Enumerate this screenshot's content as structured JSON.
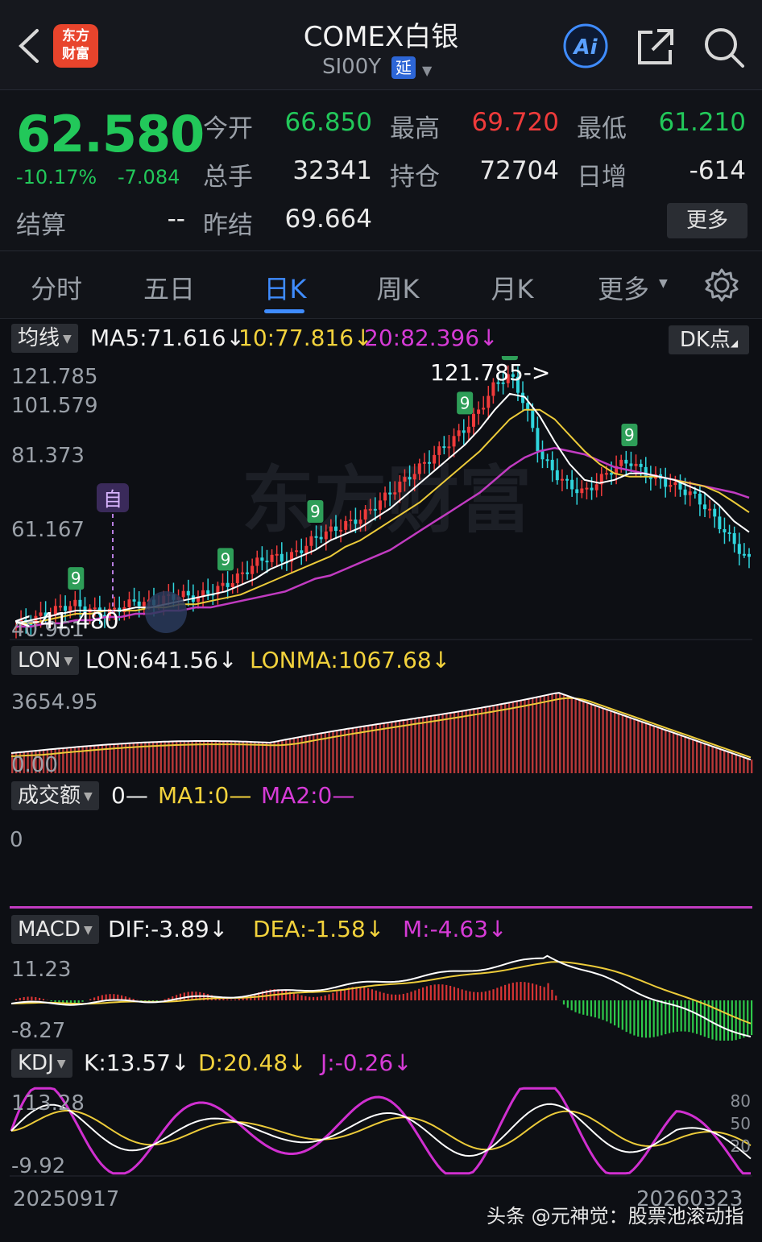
{
  "header": {
    "title": "COMEX白银",
    "subtitle": "SI00Y",
    "delay_badge": "延",
    "logo_line1": "东方",
    "logo_line2": "财富",
    "ai_label": "Ai"
  },
  "quote": {
    "price": "62.580",
    "change_pct": "-10.17%",
    "change": "-7.084",
    "fields": [
      {
        "label": "今开",
        "value": "66.850"
      },
      {
        "label": "最高",
        "value": "69.720"
      },
      {
        "label": "最低",
        "value": "61.210"
      },
      {
        "label": "总手",
        "value": "32341"
      },
      {
        "label": "持仓",
        "value": "72704"
      },
      {
        "label": "日增",
        "value": "-614"
      },
      {
        "label": "结算",
        "value": "--"
      },
      {
        "label": "昨结",
        "value": "69.664"
      }
    ],
    "more_label": "更多"
  },
  "tabs": [
    "分时",
    "五日",
    "日K",
    "周K",
    "月K",
    "更多"
  ],
  "active_tab": "日K",
  "main_chart": {
    "indicator": "均线",
    "ma5": "MA5:71.616",
    "ma10": "10:77.816",
    "ma20": "20:82.396",
    "dk_label": "DK点",
    "y_labels": [
      "121.785",
      "101.579",
      "81.373",
      "61.167",
      "40.961"
    ],
    "max_label": "121.785->",
    "min_label": "<-41.480",
    "marker_label": "自"
  },
  "lon_panel": {
    "name": "LON",
    "lon": "LON:641.56",
    "lonma": "LONMA:1067.68",
    "y_labels": [
      "3654.95",
      "0.00"
    ]
  },
  "vol_panel": {
    "name": "成交额",
    "v0": "0—",
    "ma1": "MA1:0—",
    "ma2": "MA2:0—",
    "y_label": "0"
  },
  "macd_panel": {
    "name": "MACD",
    "dif": "DIF:-3.89",
    "dea": "DEA:-1.58",
    "m": "M:-4.63",
    "y_labels": [
      "11.23",
      "-8.27"
    ]
  },
  "kdj_panel": {
    "name": "KDJ",
    "k": "K:13.57",
    "d": "D:20.48",
    "j": "J:-0.26",
    "y_labels": [
      "113.28",
      "-9.92"
    ],
    "right_labels": [
      "80",
      "50",
      "20"
    ]
  },
  "dates": {
    "start": "20250917",
    "end": "20260323"
  },
  "watermark": "头条 @元神觉：股票池滚动指",
  "chart_data": {
    "type": "line",
    "title": "COMEX白银 日K",
    "x_range": [
      "20250917",
      "20260323"
    ],
    "ylim": [
      40.961,
      121.785
    ],
    "series": [
      {
        "name": "close",
        "values": [
          42,
          44,
          46,
          48,
          49,
          47,
          46,
          48,
          50,
          49,
          51,
          52,
          51,
          53,
          55,
          58,
          62,
          64,
          63,
          66,
          70,
          72,
          74,
          76,
          80,
          84,
          88,
          92,
          96,
          100,
          104,
          110,
          118,
          121,
          112,
          96,
          90,
          86,
          84,
          88,
          92,
          94,
          90,
          88,
          86,
          84,
          80,
          74,
          68,
          62.58
        ]
      },
      {
        "name": "MA5",
        "values": [
          43,
          44,
          45,
          46,
          47,
          47,
          47,
          47,
          48,
          48,
          49,
          50,
          51,
          52,
          53,
          55,
          57,
          60,
          62,
          64,
          66,
          69,
          71,
          73,
          76,
          79,
          83,
          87,
          91,
          95,
          99,
          104,
          110,
          115,
          114,
          108,
          100,
          93,
          88,
          87,
          88,
          90,
          90,
          89,
          88,
          86,
          84,
          80,
          75,
          71.616
        ]
      },
      {
        "name": "MA10",
        "values": [
          43,
          43,
          44,
          45,
          46,
          46,
          47,
          47,
          47,
          48,
          48,
          49,
          49,
          50,
          51,
          52,
          54,
          56,
          58,
          60,
          62,
          64,
          67,
          69,
          72,
          75,
          78,
          81,
          85,
          89,
          93,
          97,
          102,
          107,
          110,
          110,
          107,
          102,
          97,
          93,
          90,
          89,
          89,
          89,
          88,
          87,
          86,
          84,
          81,
          77.816
        ]
      },
      {
        "name": "MA20",
        "values": [
          42,
          42,
          43,
          43,
          44,
          44,
          45,
          45,
          46,
          46,
          47,
          47,
          48,
          48,
          49,
          50,
          51,
          52,
          53,
          55,
          57,
          58,
          60,
          62,
          64,
          66,
          69,
          72,
          75,
          78,
          81,
          84,
          88,
          92,
          95,
          97,
          98,
          97,
          96,
          94,
          92,
          91,
          90,
          89,
          88,
          87,
          86,
          85,
          84,
          82.396
        ]
      }
    ]
  }
}
